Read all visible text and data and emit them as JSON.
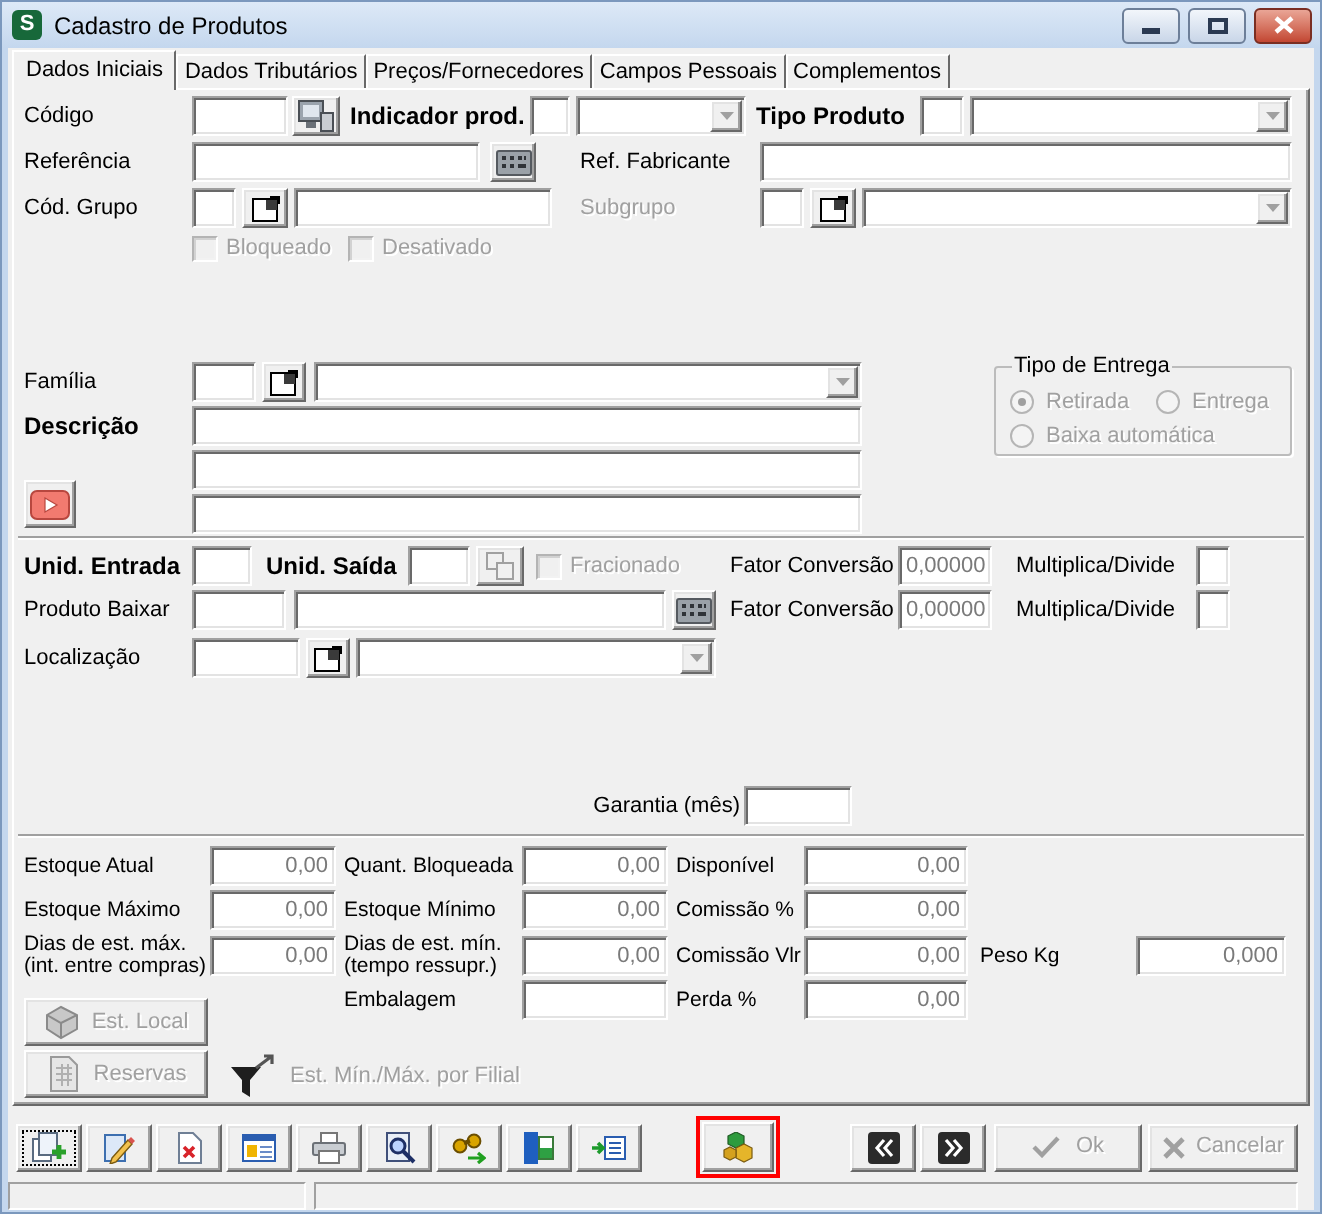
{
  "window": {
    "logo": "S",
    "title": "Cadastro de Produtos"
  },
  "tabs": [
    {
      "label": "Dados Iniciais",
      "selected": true
    },
    {
      "label": "Dados Tributários",
      "selected": false
    },
    {
      "label": "Preços/Fornecedores",
      "selected": false
    },
    {
      "label": "Campos Pessoais",
      "selected": false
    },
    {
      "label": "Complementos",
      "selected": false
    }
  ],
  "product": {
    "code": {
      "label": "Código"
    },
    "product_indicator": {
      "label": "Indicador prod."
    },
    "product_type": {
      "label": "Tipo Produto"
    },
    "reference": {
      "label": "Referência"
    },
    "manufacturer_ref": {
      "label": "Ref. Fabricante"
    },
    "group_code": {
      "label": "Cód. Grupo"
    },
    "subgroup": {
      "label": "Subgrupo",
      "disabled": true
    },
    "flags": [
      {
        "label": "Bloqueado",
        "checked": false,
        "disabled": true
      },
      {
        "label": "Desativado",
        "checked": false,
        "disabled": true
      }
    ],
    "family": {
      "label": "Família"
    },
    "description": {
      "label": "Descrição"
    }
  },
  "delivery_type": {
    "title": "Tipo de Entrega",
    "options": [
      {
        "label": "Retirada",
        "selected": true,
        "disabled": true
      },
      {
        "label": "Entrega",
        "selected": false,
        "disabled": true
      },
      {
        "label": "Baixa automática",
        "selected": false,
        "disabled": true
      }
    ]
  },
  "units": {
    "entry": {
      "label": "Unid. Entrada"
    },
    "exit": {
      "label": "Unid. Saída"
    },
    "fractional": {
      "label": "Fracionado",
      "checked": false,
      "disabled": true
    },
    "product_to_deduct": {
      "label": "Produto Baixar"
    },
    "conversions": [
      {
        "label": "Fator Conversão",
        "value": "0,00000",
        "disabled": true,
        "operation_label": "Multiplica/Divide"
      },
      {
        "label": "Fator Conversão",
        "value": "0,00000",
        "disabled": true,
        "operation_label": "Multiplica/Divide"
      }
    ]
  },
  "location": {
    "label": "Localização"
  },
  "warranty": {
    "label": "Garantia (mês)"
  },
  "stock": {
    "rows": [
      {
        "cells": [
          {
            "label": "Estoque Atual",
            "value": "0,00",
            "disabled": true
          },
          {
            "label": "Quant. Bloqueada",
            "value": "0,00",
            "disabled": true
          },
          {
            "label": "Disponível",
            "value": "0,00",
            "disabled": true
          }
        ]
      },
      {
        "cells": [
          {
            "label": "Estoque Máximo",
            "value": "0,00",
            "disabled": true
          },
          {
            "label": "Estoque Mínimo",
            "value": "0,00",
            "disabled": true
          },
          {
            "label": "Comissão %",
            "value": "0,00",
            "disabled": true
          }
        ]
      },
      {
        "cells": [
          {
            "label": "Dias de est. máx. (int. entre compras)",
            "value": "0,00",
            "disabled": true
          },
          {
            "label": "Dias de est. mín. (tempo ressupr.)",
            "value": "0,00",
            "disabled": true
          },
          {
            "label": "Comissão Vlr",
            "value": "0,00",
            "disabled": true
          },
          {
            "label": "Peso Kg",
            "value": "0,000",
            "disabled": true
          }
        ]
      }
    ],
    "extra": [
      {
        "label": "Embalagem"
      },
      {
        "label": "Perda %",
        "value": "0,00",
        "disabled": true
      }
    ],
    "buttons": [
      {
        "label": "Est. Local",
        "disabled": true
      },
      {
        "label": "Reservas",
        "disabled": true
      }
    ],
    "per_branch": {
      "label": "Est. Mín./Máx. por Filial",
      "disabled": true
    }
  },
  "toolbar": {
    "icon_buttons": [
      {
        "focused": true,
        "highlighted": false
      },
      {
        "focused": false,
        "highlighted": false
      },
      {
        "focused": false,
        "highlighted": false
      },
      {
        "focused": false,
        "highlighted": false
      },
      {
        "focused": false,
        "highlighted": false
      },
      {
        "focused": false,
        "highlighted": false
      },
      {
        "focused": false,
        "highlighted": false
      },
      {
        "focused": false,
        "highlighted": false
      },
      {
        "focused": false,
        "highlighted": false
      },
      {
        "focused": false,
        "highlighted": true
      }
    ],
    "ok": {
      "label": "Ok",
      "disabled": true
    },
    "cancel": {
      "label": "Cancelar",
      "disabled": true
    }
  }
}
